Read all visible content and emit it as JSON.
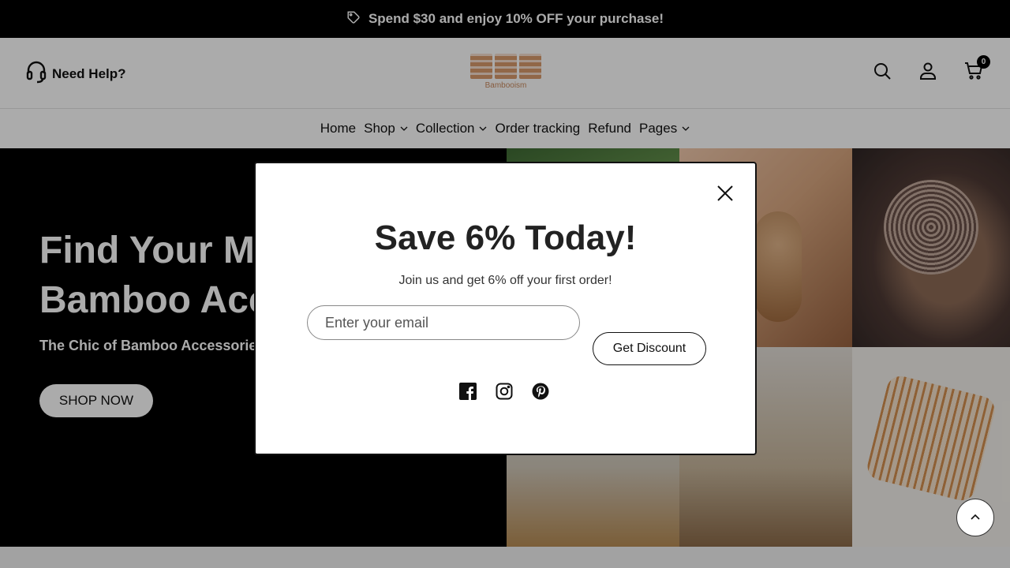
{
  "announcement": {
    "text": "Spend $30 and enjoy 10% OFF your purchase!",
    "icon": "tag-icon"
  },
  "header": {
    "help_label": "Need Help?",
    "help_icon": "headset-icon",
    "logo_text": "Bambooism",
    "icons": [
      "search-icon",
      "account-icon",
      "cart-icon"
    ],
    "cart_count": "0"
  },
  "nav": {
    "items": [
      {
        "label": "Home",
        "dropdown": false
      },
      {
        "label": "Shop",
        "dropdown": true
      },
      {
        "label": "Collection",
        "dropdown": true
      },
      {
        "label": "Order tracking",
        "dropdown": false
      },
      {
        "label": "Refund",
        "dropdown": false
      },
      {
        "label": "Pages",
        "dropdown": true
      }
    ]
  },
  "hero": {
    "title": "Find Your Mo\nBamboo Acce",
    "subtitle": "The Chic of Bamboo Accessories",
    "cta_label": "SHOP NOW"
  },
  "popup": {
    "title": "Save 6% Today!",
    "subtitle": "Join us and get 6% off your first order!",
    "email_placeholder": "Enter your email",
    "email_value": "",
    "submit_label": "Get Discount",
    "social_icons": [
      "facebook-icon",
      "instagram-icon",
      "pinterest-icon"
    ]
  },
  "colors": {
    "announcement_bg": "#000000",
    "overlay": "rgba(0,0,0,0.33)",
    "logo_accent": "#d99a6c"
  }
}
